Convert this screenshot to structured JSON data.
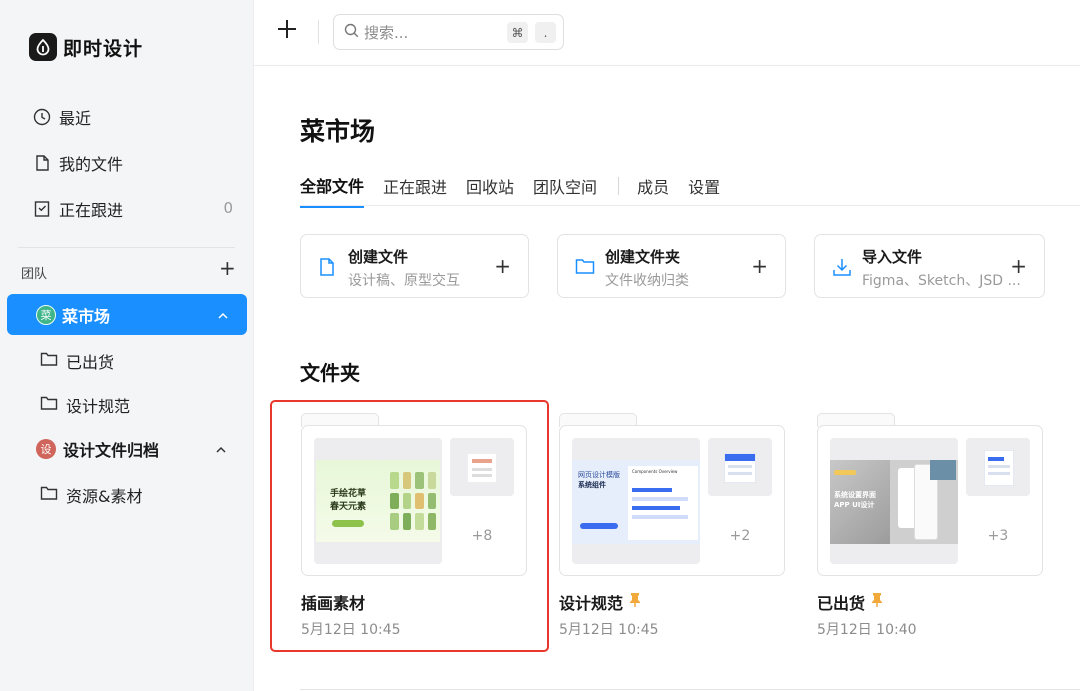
{
  "app": {
    "name": "即时设计"
  },
  "sidebar": {
    "nav": [
      {
        "label": "最近",
        "icon": "clock-icon"
      },
      {
        "label": "我的文件",
        "icon": "file-icon"
      },
      {
        "label": "正在跟进",
        "icon": "bookmark-icon",
        "count": "0"
      }
    ],
    "team_label": "团队",
    "teams": [
      {
        "name": "菜市场",
        "avatar": "菜",
        "active": true,
        "folders": [
          "已出货",
          "设计规范"
        ]
      },
      {
        "name": "设计文件归档",
        "avatar": "设",
        "active": false,
        "folders": [
          "资源&素材"
        ]
      }
    ]
  },
  "topbar": {
    "search_placeholder": "搜索...",
    "shortcut_keys": [
      "⌘",
      "."
    ]
  },
  "main": {
    "title": "菜市场",
    "tabs": [
      "全部文件",
      "正在跟进",
      "回收站",
      "团队空间",
      "成员",
      "设置"
    ],
    "active_tab": "全部文件",
    "actions": [
      {
        "title": "创建文件",
        "subtitle": "设计稿、原型交互",
        "icon": "file-icon"
      },
      {
        "title": "创建文件夹",
        "subtitle": "文件收纳归类",
        "icon": "folder-icon"
      },
      {
        "title": "导入文件",
        "subtitle": "Figma、Sketch、JSD ...",
        "icon": "download-icon"
      }
    ],
    "folders_title": "文件夹",
    "folders": [
      {
        "name": "插画素材",
        "date": "5月12日 10:45",
        "more": "+8",
        "pinned": false,
        "thumb_text": [
          "手绘花草",
          "春天元素"
        ]
      },
      {
        "name": "设计规范",
        "date": "5月12日 10:45",
        "more": "+2",
        "pinned": true,
        "thumb_text": [
          "网页设计模版",
          "系统组件",
          "Components Overview"
        ]
      },
      {
        "name": "已出货",
        "date": "5月12日 10:40",
        "more": "+3",
        "pinned": true,
        "thumb_text": [
          "系统设置界面",
          "APP UI设计"
        ]
      }
    ]
  },
  "colors": {
    "accent": "#1a8fff",
    "selection": "#e8372c",
    "pin": "#f2a93b"
  }
}
